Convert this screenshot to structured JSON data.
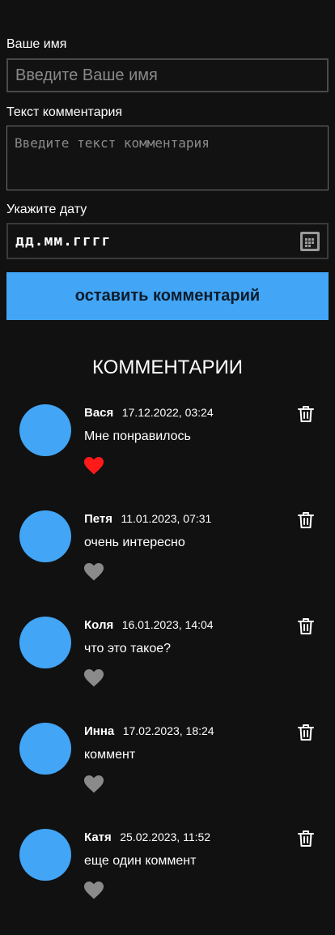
{
  "form": {
    "name_label": "Ваше имя",
    "name_placeholder": "Введите Ваше имя",
    "text_label": "Текст комментария",
    "text_placeholder": "Введите текст комментария",
    "date_label": "Укажите дату",
    "date_placeholder": "дд.мм.гггг",
    "submit_label": "оставить комментарий"
  },
  "comments_section": {
    "title": "КОММЕНТАРИИ"
  },
  "comments": [
    {
      "name": "Вася",
      "date": "17.12.2022, 03:24",
      "text": "Мне понравилось",
      "liked": true
    },
    {
      "name": "Петя",
      "date": "11.01.2023, 07:31",
      "text": "очень интересно",
      "liked": false
    },
    {
      "name": "Коля",
      "date": "16.01.2023, 14:04",
      "text": "что это такое?",
      "liked": false
    },
    {
      "name": "Инна",
      "date": "17.02.2023, 18:24",
      "text": "коммент",
      "liked": false
    },
    {
      "name": "Катя",
      "date": "25.02.2023, 11:52",
      "text": "еще один коммент",
      "liked": false
    }
  ],
  "colors": {
    "background": "#111111",
    "accent": "#42a5f5",
    "heart_liked": "#ff1a1a",
    "heart_unliked": "#8a8a8a",
    "text": "#ffffff"
  },
  "icons": {
    "like": "heart-icon",
    "delete": "trash-icon",
    "calendar": "calendar-icon"
  }
}
